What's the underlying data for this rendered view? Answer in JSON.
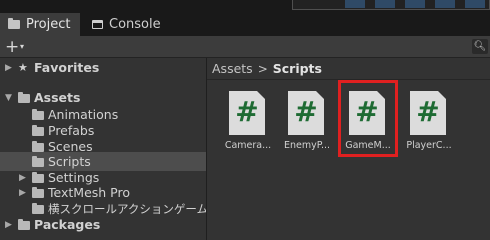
{
  "tabs": [
    {
      "label": "Project",
      "icon": "folder-icon",
      "active": true
    },
    {
      "label": "Console",
      "icon": "console-icon",
      "active": false
    }
  ],
  "toolbar": {
    "add": "+",
    "add_menu": "▾",
    "search_icon": "magnifier-icon"
  },
  "tree": {
    "favorites": "Favorites",
    "assets": "Assets",
    "folders": [
      "Animations",
      "Prefabs",
      "Scenes",
      "Scripts",
      "Settings",
      "TextMesh Pro",
      "横スクロールアクションゲーム画像素"
    ],
    "selected": "Scripts",
    "packages": "Packages"
  },
  "breadcrumb": {
    "root": "Assets",
    "separator": ">",
    "current": "Scripts"
  },
  "assets": [
    {
      "name": "Camera...",
      "glyph": "#"
    },
    {
      "name": "EnemyP...",
      "glyph": "#"
    },
    {
      "name": "GameM...",
      "glyph": "#",
      "highlighted": true
    },
    {
      "name": "PlayerC...",
      "glyph": "#"
    }
  ],
  "colors": {
    "script_glyph": "#1e6b33",
    "highlight": "#e02020"
  }
}
